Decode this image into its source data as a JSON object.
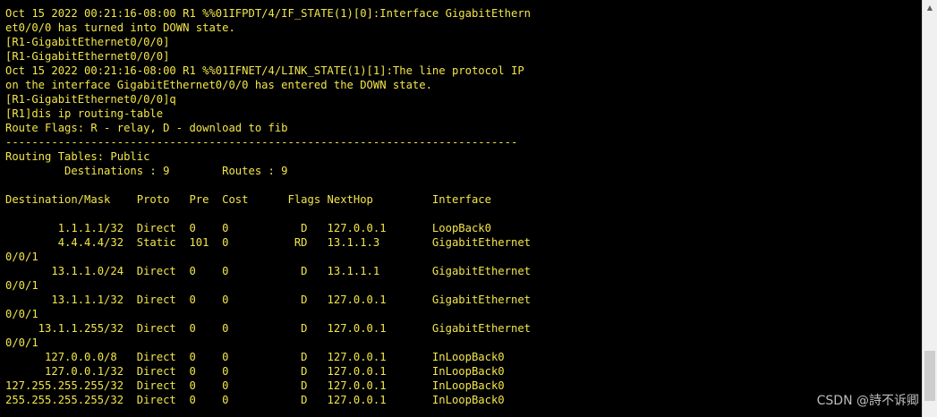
{
  "terminal": {
    "lines": [
      "Oct 15 2022 00:21:16-08:00 R1 %%01IFPDT/4/IF_STATE(1)[0]:Interface GigabitEthern",
      "et0/0/0 has turned into DOWN state.",
      "[R1-GigabitEthernet0/0/0]",
      "[R1-GigabitEthernet0/0/0]",
      "Oct 15 2022 00:21:16-08:00 R1 %%01IFNET/4/LINK_STATE(1)[1]:The line protocol IP",
      "on the interface GigabitEthernet0/0/0 has entered the DOWN state.",
      "[R1-GigabitEthernet0/0/0]q",
      "[R1]dis ip routing-table",
      "Route Flags: R - relay, D - download to fib",
      "------------------------------------------------------------------------------",
      "Routing Tables: Public",
      "         Destinations : 9        Routes : 9",
      "",
      "Destination/Mask    Proto   Pre  Cost      Flags NextHop         Interface",
      "",
      "        1.1.1.1/32  Direct  0    0           D   127.0.0.1       LoopBack0",
      "        4.4.4.4/32  Static  101  0          RD   13.1.1.3        GigabitEthernet",
      "0/0/1",
      "       13.1.1.0/24  Direct  0    0           D   13.1.1.1        GigabitEthernet",
      "0/0/1",
      "       13.1.1.1/32  Direct  0    0           D   127.0.0.1       GigabitEthernet",
      "0/0/1",
      "     13.1.1.255/32  Direct  0    0           D   127.0.0.1       GigabitEthernet",
      "0/0/1",
      "      127.0.0.0/8   Direct  0    0           D   127.0.0.1       InLoopBack0",
      "      127.0.0.1/32  Direct  0    0           D   127.0.0.1       InLoopBack0",
      "127.255.255.255/32  Direct  0    0           D   127.0.0.1       InLoopBack0",
      "255.255.255.255/32  Direct  0    0           D   127.0.0.1       InLoopBack0"
    ]
  },
  "watermark": "CSDN @詩不诉卿",
  "colors": {
    "background": "#000000",
    "text": "#f2e64a"
  }
}
